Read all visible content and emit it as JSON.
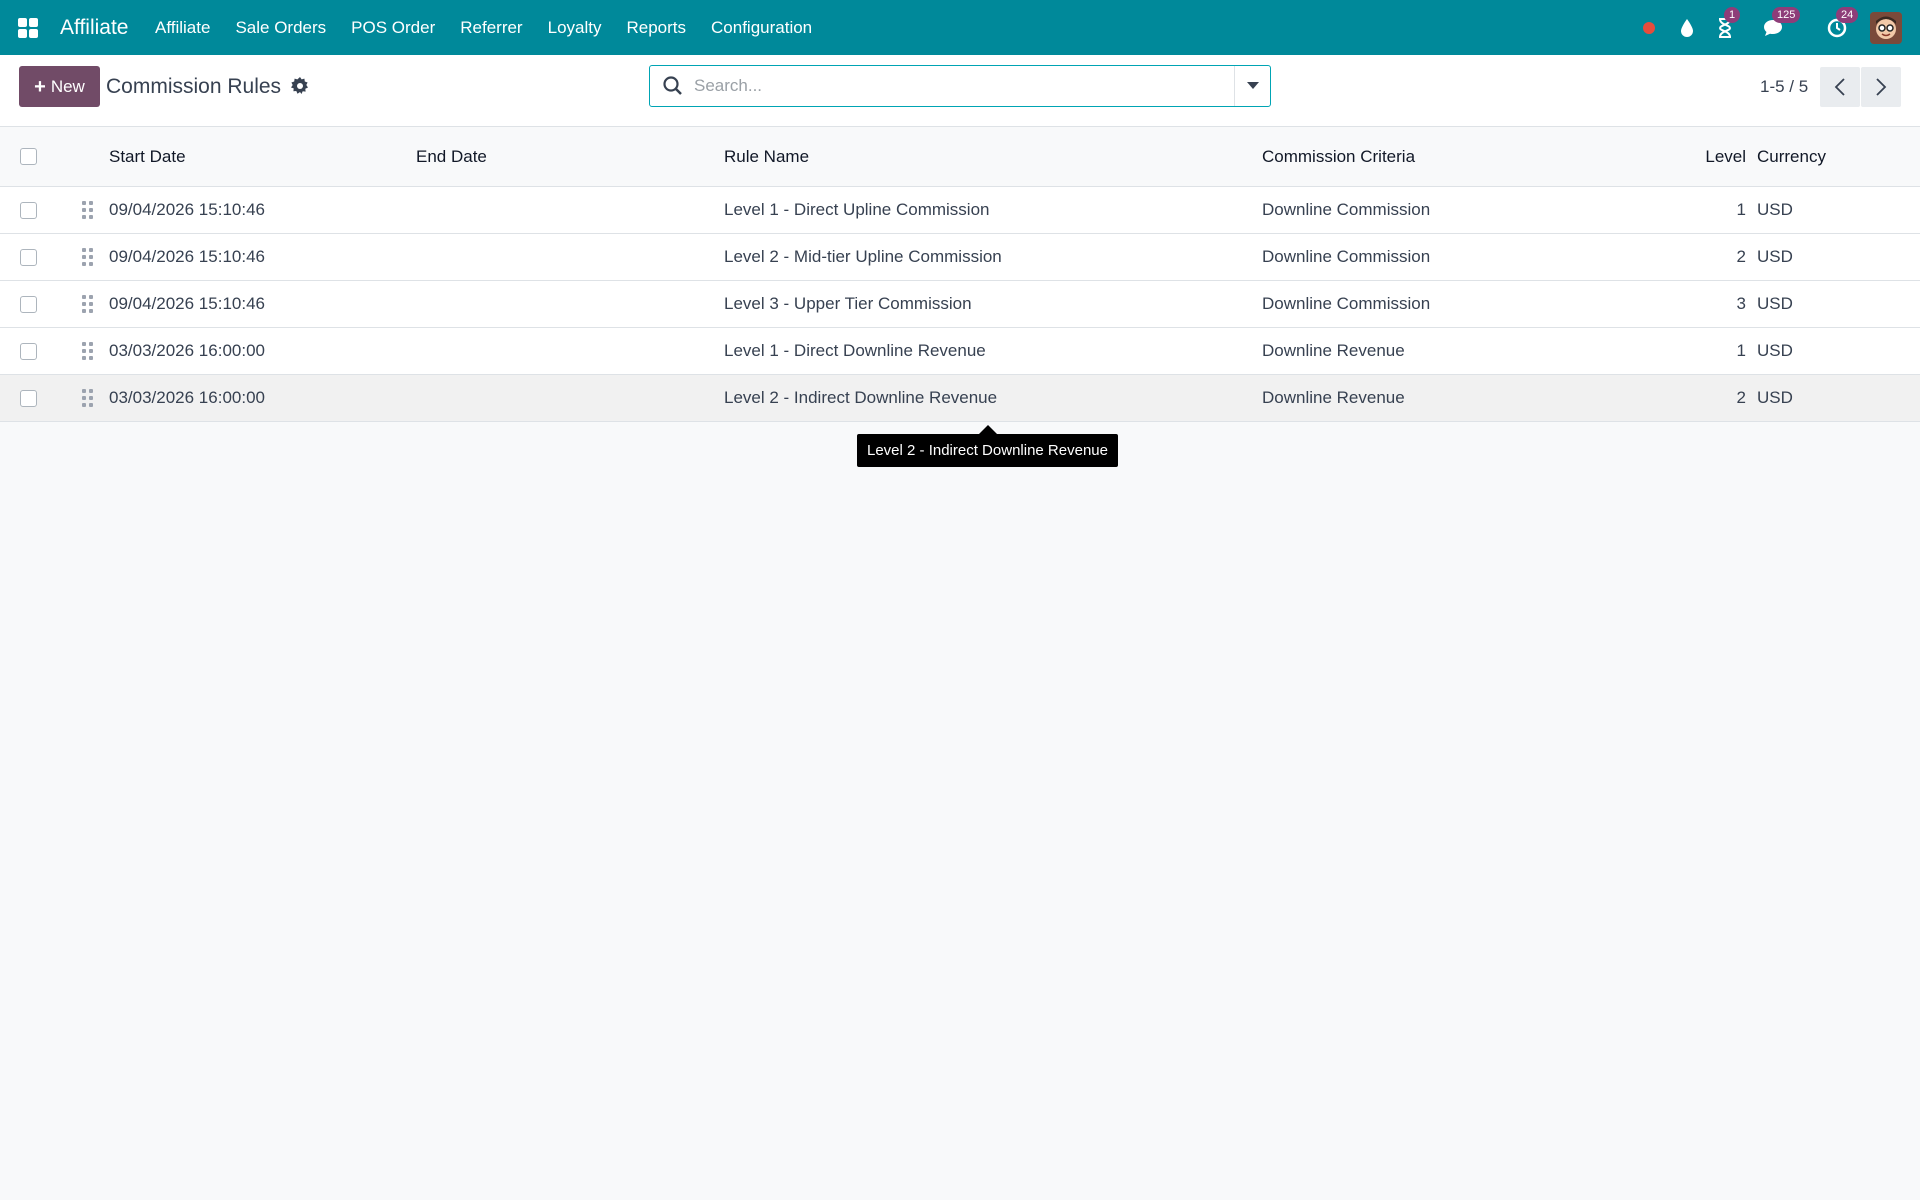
{
  "navbar": {
    "brand": "Affiliate",
    "menu": [
      "Affiliate",
      "Sale Orders",
      "POS Order",
      "Referrer",
      "Loyalty",
      "Reports",
      "Configuration"
    ],
    "activity_badge": "1",
    "messages_badge": "125",
    "updates_badge": "24",
    "status_color": "#e74c3c"
  },
  "control": {
    "new_label": "New",
    "title": "Commission Rules",
    "search_placeholder": "Search...",
    "pager": "1-5 / 5"
  },
  "table": {
    "columns": {
      "start_date": "Start Date",
      "end_date": "End Date",
      "rule_name": "Rule Name",
      "criteria": "Commission Criteria",
      "level": "Level",
      "currency": "Currency"
    },
    "rows": [
      {
        "start_date": "09/04/2026 15:10:46",
        "end_date": "",
        "rule_name": "Level 1 - Direct Upline Commission",
        "criteria": "Downline Commission",
        "level": "1",
        "currency": "USD"
      },
      {
        "start_date": "09/04/2026 15:10:46",
        "end_date": "",
        "rule_name": "Level 2 - Mid-tier Upline Commission",
        "criteria": "Downline Commission",
        "level": "2",
        "currency": "USD"
      },
      {
        "start_date": "09/04/2026 15:10:46",
        "end_date": "",
        "rule_name": "Level 3 - Upper Tier Commission",
        "criteria": "Downline Commission",
        "level": "3",
        "currency": "USD"
      },
      {
        "start_date": "03/03/2026 16:00:00",
        "end_date": "",
        "rule_name": "Level 1 - Direct Downline Revenue",
        "criteria": "Downline Revenue",
        "level": "1",
        "currency": "USD"
      },
      {
        "start_date": "03/03/2026 16:00:00",
        "end_date": "",
        "rule_name": "Level 2 - Indirect Downline Revenue",
        "criteria": "Downline Revenue",
        "level": "2",
        "currency": "USD"
      }
    ]
  },
  "tooltip": "Level 2 - Indirect Downline Revenue",
  "colors": {
    "navbar": "#00899a",
    "primary_button": "#714b67",
    "badge": "#8e3d79"
  }
}
